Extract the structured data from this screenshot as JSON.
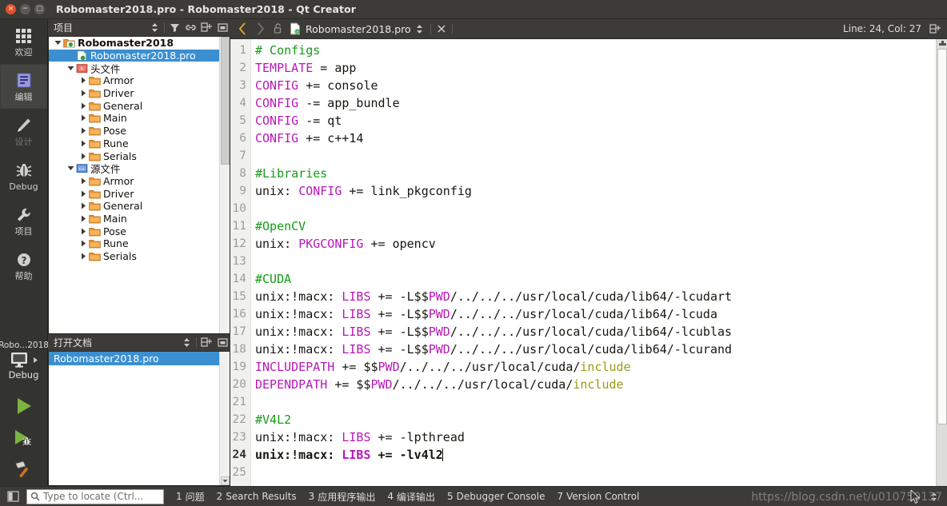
{
  "window": {
    "title": "Robomaster2018.pro - Robomaster2018 - Qt Creator",
    "close_glyph": "×",
    "min_glyph": "−",
    "max_glyph": "□"
  },
  "modebar": {
    "items": [
      {
        "label": "欢迎",
        "icon": "grid-icon",
        "state": "normal"
      },
      {
        "label": "编辑",
        "icon": "edit-icon",
        "state": "active"
      },
      {
        "label": "设计",
        "icon": "pencil-icon",
        "state": "disabled"
      },
      {
        "label": "Debug",
        "icon": "bug-icon",
        "state": "normal"
      },
      {
        "label": "项目",
        "icon": "wrench-icon",
        "state": "normal"
      },
      {
        "label": "帮助",
        "icon": "help-icon",
        "state": "normal"
      }
    ],
    "kit": {
      "project": "Robo...2018",
      "build_config": "Debug",
      "run_label": "run-button",
      "debug_label": "debug-button",
      "build_label": "build-button"
    }
  },
  "project_panel": {
    "title": "项目",
    "tools": [
      "filter-icon",
      "link-icon",
      "split-icon",
      "close-icon"
    ],
    "tree": [
      {
        "indent": 0,
        "arrow": "down",
        "icon": "project-folder-icon",
        "label": "Robomaster2018",
        "bold": true,
        "selected": false
      },
      {
        "indent": 1,
        "arrow": "none",
        "icon": "pro-file-icon",
        "label": "Robomaster2018.pro",
        "bold": false,
        "selected": true
      },
      {
        "indent": 1,
        "arrow": "down",
        "icon": "headers-icon",
        "label": "头文件",
        "bold": false,
        "selected": false
      },
      {
        "indent": 2,
        "arrow": "right",
        "icon": "folder-icon",
        "label": "Armor",
        "bold": false,
        "selected": false
      },
      {
        "indent": 2,
        "arrow": "right",
        "icon": "folder-icon",
        "label": "Driver",
        "bold": false,
        "selected": false
      },
      {
        "indent": 2,
        "arrow": "right",
        "icon": "folder-icon",
        "label": "General",
        "bold": false,
        "selected": false
      },
      {
        "indent": 2,
        "arrow": "right",
        "icon": "folder-icon",
        "label": "Main",
        "bold": false,
        "selected": false
      },
      {
        "indent": 2,
        "arrow": "right",
        "icon": "folder-icon",
        "label": "Pose",
        "bold": false,
        "selected": false
      },
      {
        "indent": 2,
        "arrow": "right",
        "icon": "folder-icon",
        "label": "Rune",
        "bold": false,
        "selected": false
      },
      {
        "indent": 2,
        "arrow": "right",
        "icon": "folder-icon",
        "label": "Serials",
        "bold": false,
        "selected": false
      },
      {
        "indent": 1,
        "arrow": "down",
        "icon": "sources-icon",
        "label": "源文件",
        "bold": false,
        "selected": false
      },
      {
        "indent": 2,
        "arrow": "right",
        "icon": "folder-icon",
        "label": "Armor",
        "bold": false,
        "selected": false
      },
      {
        "indent": 2,
        "arrow": "right",
        "icon": "folder-icon",
        "label": "Driver",
        "bold": false,
        "selected": false
      },
      {
        "indent": 2,
        "arrow": "right",
        "icon": "folder-icon",
        "label": "General",
        "bold": false,
        "selected": false
      },
      {
        "indent": 2,
        "arrow": "right",
        "icon": "folder-icon",
        "label": "Main",
        "bold": false,
        "selected": false
      },
      {
        "indent": 2,
        "arrow": "right",
        "icon": "folder-icon",
        "label": "Pose",
        "bold": false,
        "selected": false
      },
      {
        "indent": 2,
        "arrow": "right",
        "icon": "folder-icon",
        "label": "Rune",
        "bold": false,
        "selected": false
      },
      {
        "indent": 2,
        "arrow": "right",
        "icon": "folder-icon",
        "label": "Serials",
        "bold": false,
        "selected": false
      }
    ]
  },
  "open_documents": {
    "title": "打开文档",
    "tools": [
      "split-icon",
      "close-icon"
    ],
    "items": [
      {
        "label": "Robomaster2018.pro",
        "selected": true
      }
    ]
  },
  "editor": {
    "filename": "Robomaster2018.pro",
    "line_col": "Line: 24, Col: 27",
    "nav_back": "‹",
    "nav_forward": "›",
    "close_glyph": "×",
    "current_line": 24,
    "total_lines": 25,
    "lines": [
      {
        "n": 1,
        "tokens": [
          {
            "t": "# Configs",
            "c": "cmt"
          }
        ]
      },
      {
        "n": 2,
        "tokens": [
          {
            "t": "TEMPLATE",
            "c": "kw"
          },
          {
            "t": " = app",
            "c": ""
          }
        ]
      },
      {
        "n": 3,
        "tokens": [
          {
            "t": "CONFIG",
            "c": "kw"
          },
          {
            "t": " += console",
            "c": ""
          }
        ]
      },
      {
        "n": 4,
        "tokens": [
          {
            "t": "CONFIG",
            "c": "kw"
          },
          {
            "t": " -= app_bundle",
            "c": ""
          }
        ]
      },
      {
        "n": 5,
        "tokens": [
          {
            "t": "CONFIG",
            "c": "kw"
          },
          {
            "t": " -= qt",
            "c": ""
          }
        ]
      },
      {
        "n": 6,
        "tokens": [
          {
            "t": "CONFIG",
            "c": "kw"
          },
          {
            "t": " += c++14",
            "c": ""
          }
        ]
      },
      {
        "n": 7,
        "tokens": []
      },
      {
        "n": 8,
        "tokens": [
          {
            "t": "#Libraries",
            "c": "cmt"
          }
        ]
      },
      {
        "n": 9,
        "tokens": [
          {
            "t": "unix: ",
            "c": ""
          },
          {
            "t": "CONFIG",
            "c": "kw"
          },
          {
            "t": " += link_pkgconfig",
            "c": ""
          }
        ]
      },
      {
        "n": 10,
        "tokens": []
      },
      {
        "n": 11,
        "tokens": [
          {
            "t": "#OpenCV",
            "c": "cmt"
          }
        ]
      },
      {
        "n": 12,
        "tokens": [
          {
            "t": "unix: ",
            "c": ""
          },
          {
            "t": "PKGCONFIG",
            "c": "kw"
          },
          {
            "t": " += opencv",
            "c": ""
          }
        ]
      },
      {
        "n": 13,
        "tokens": []
      },
      {
        "n": 14,
        "tokens": [
          {
            "t": "#CUDA",
            "c": "cmt"
          }
        ]
      },
      {
        "n": 15,
        "tokens": [
          {
            "t": "unix:!macx: ",
            "c": ""
          },
          {
            "t": "LIBS",
            "c": "kw"
          },
          {
            "t": " += -L$$",
            "c": ""
          },
          {
            "t": "PWD",
            "c": "kw"
          },
          {
            "t": "/../../../usr/local/cuda/lib64/-lcudart",
            "c": ""
          }
        ]
      },
      {
        "n": 16,
        "tokens": [
          {
            "t": "unix:!macx: ",
            "c": ""
          },
          {
            "t": "LIBS",
            "c": "kw"
          },
          {
            "t": " += -L$$",
            "c": ""
          },
          {
            "t": "PWD",
            "c": "kw"
          },
          {
            "t": "/../../../usr/local/cuda/lib64/-lcuda",
            "c": ""
          }
        ]
      },
      {
        "n": 17,
        "tokens": [
          {
            "t": "unix:!macx: ",
            "c": ""
          },
          {
            "t": "LIBS",
            "c": "kw"
          },
          {
            "t": " += -L$$",
            "c": ""
          },
          {
            "t": "PWD",
            "c": "kw"
          },
          {
            "t": "/../../../usr/local/cuda/lib64/-lcublas",
            "c": ""
          }
        ]
      },
      {
        "n": 18,
        "tokens": [
          {
            "t": "unix:!macx: ",
            "c": ""
          },
          {
            "t": "LIBS",
            "c": "kw"
          },
          {
            "t": " += -L$$",
            "c": ""
          },
          {
            "t": "PWD",
            "c": "kw"
          },
          {
            "t": "/../../../usr/local/cuda/lib64/-lcurand",
            "c": ""
          }
        ]
      },
      {
        "n": 19,
        "tokens": [
          {
            "t": "INCLUDEPATH",
            "c": "kw"
          },
          {
            "t": " += $$",
            "c": ""
          },
          {
            "t": "PWD",
            "c": "kw"
          },
          {
            "t": "/../../../usr/local/cuda/",
            "c": ""
          },
          {
            "t": "include",
            "c": "inc"
          }
        ]
      },
      {
        "n": 20,
        "tokens": [
          {
            "t": "DEPENDPATH",
            "c": "kw"
          },
          {
            "t": " += $$",
            "c": ""
          },
          {
            "t": "PWD",
            "c": "kw"
          },
          {
            "t": "/../../../usr/local/cuda/",
            "c": ""
          },
          {
            "t": "include",
            "c": "inc"
          }
        ]
      },
      {
        "n": 21,
        "tokens": []
      },
      {
        "n": 22,
        "tokens": [
          {
            "t": "#V4L2",
            "c": "cmt"
          }
        ]
      },
      {
        "n": 23,
        "tokens": [
          {
            "t": "unix:!macx: ",
            "c": ""
          },
          {
            "t": "LIBS",
            "c": "kw"
          },
          {
            "t": " += -lpthread",
            "c": ""
          }
        ]
      },
      {
        "n": 24,
        "tokens": [
          {
            "t": "unix:!macx: ",
            "c": ""
          },
          {
            "t": "LIBS",
            "c": "kw"
          },
          {
            "t": " += -lv4l2",
            "c": ""
          }
        ],
        "caret": true
      },
      {
        "n": 25,
        "tokens": []
      }
    ]
  },
  "statusbar": {
    "sidebar_toggle": "sidebar-toggle-icon",
    "locator_placeholder": "Type to locate (Ctrl...",
    "search_icon": "search-icon",
    "output_tabs": [
      {
        "num": "1",
        "label": "问题"
      },
      {
        "num": "2",
        "label": "Search Results"
      },
      {
        "num": "3",
        "label": "应用程序输出"
      },
      {
        "num": "4",
        "label": "编译输出"
      },
      {
        "num": "5",
        "label": "Debugger Console"
      },
      {
        "num": "7",
        "label": "Version Control"
      }
    ],
    "watermark": "https://blog.csdn.net/u010750137"
  },
  "colors": {
    "chrome": "#3c3b37",
    "mode_bar": "#333330",
    "selection_blue": "#3b8fd1",
    "comment_green": "#169b16",
    "keyword_magenta": "#b818b8",
    "include_olive": "#9a9a15",
    "folder_orange": "#e8922e"
  }
}
